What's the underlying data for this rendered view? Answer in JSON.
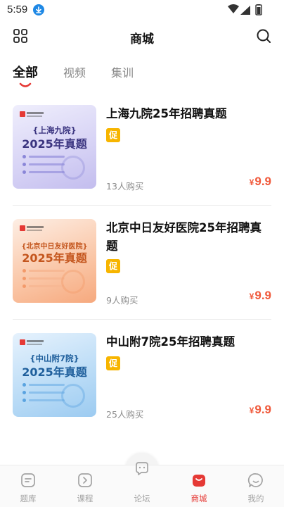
{
  "status_bar": {
    "time": "5:59"
  },
  "header": {
    "title": "商城"
  },
  "tabs": [
    {
      "label": "全部",
      "active": true
    },
    {
      "label": "视频",
      "active": false
    },
    {
      "label": "集训",
      "active": false
    }
  ],
  "products": [
    {
      "title": "上海九院25年招聘真题",
      "badge": "促",
      "buyers": "13人购买",
      "currency": "¥",
      "price": "9.9",
      "thumb": {
        "name": "{上海九院}",
        "year": "2025年真题",
        "theme": "#8a86d8",
        "bg_top": "#eceafb",
        "bg_bottom": "#c9c4f0",
        "text_color": "#3b3580"
      }
    },
    {
      "title": "北京中日友好医院25年招聘真题",
      "badge": "促",
      "buyers": "9人购买",
      "currency": "¥",
      "price": "9.9",
      "thumb": {
        "name": "{北京中日友好医院}",
        "year": "2025年真题",
        "theme": "#f39a6a",
        "bg_top": "#fde8dc",
        "bg_bottom": "#f8b894",
        "text_color": "#c4561e"
      }
    },
    {
      "title": "中山附7院25年招聘真题",
      "badge": "促",
      "buyers": "25人购买",
      "currency": "¥",
      "price": "9.9",
      "thumb": {
        "name": "{中山附7院}",
        "year": "2025年真题",
        "theme": "#5aa3e0",
        "bg_top": "#e2f0fc",
        "bg_bottom": "#a8d2f4",
        "text_color": "#1f5f9c"
      }
    }
  ],
  "bottom_nav": [
    {
      "label": "题库",
      "icon": "question-bank-icon",
      "active": false
    },
    {
      "label": "课程",
      "icon": "course-play-icon",
      "active": false
    },
    {
      "label": "论坛",
      "icon": "forum-chat-icon",
      "active": false
    },
    {
      "label": "商城",
      "icon": "shop-bag-icon",
      "active": true
    },
    {
      "label": "我的",
      "icon": "profile-smile-icon",
      "active": false
    }
  ],
  "colors": {
    "accent": "#e53935",
    "price": "#f05a3c",
    "promo": "#f7b500"
  }
}
